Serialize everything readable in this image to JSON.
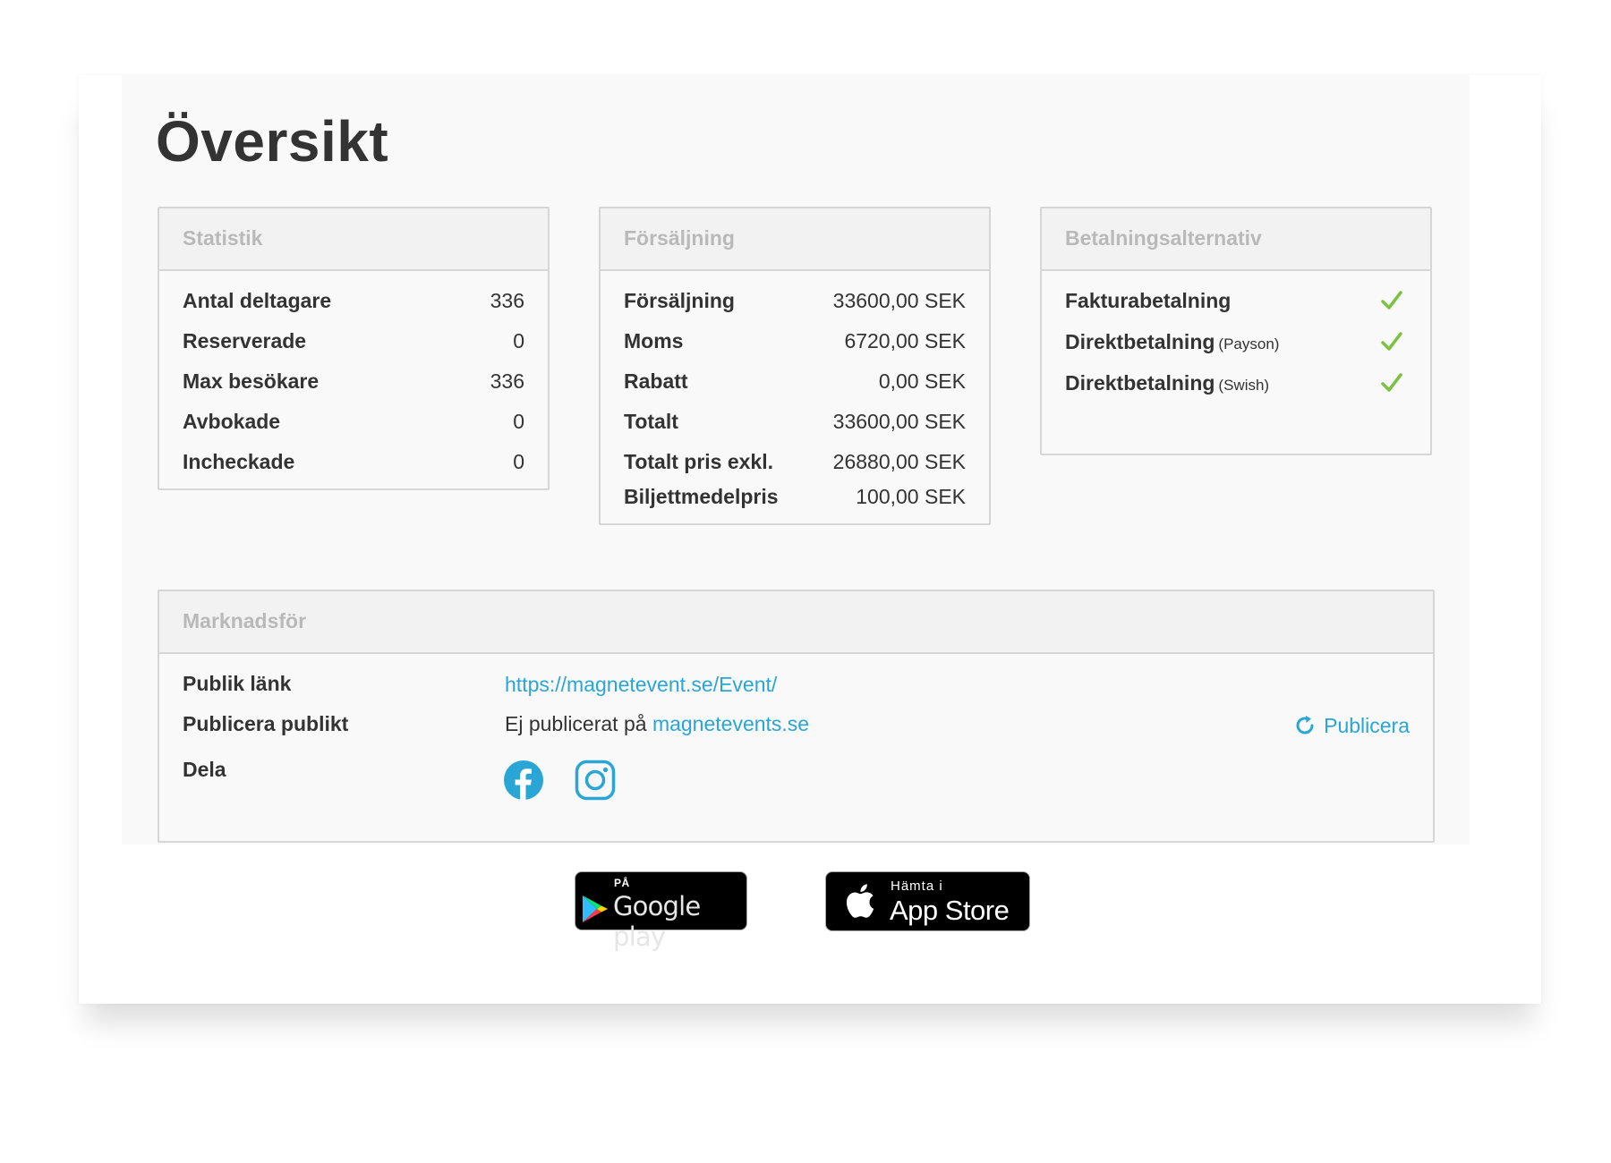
{
  "page": {
    "title": "Översikt"
  },
  "statistik": {
    "header": "Statistik",
    "rows": [
      {
        "label": "Antal deltagare",
        "value": "336"
      },
      {
        "label": "Reserverade",
        "value": "0"
      },
      {
        "label": "Max besökare",
        "value": "336"
      },
      {
        "label": "Avbokade",
        "value": "0"
      },
      {
        "label": "Incheckade",
        "value": "0"
      }
    ]
  },
  "forsaljning": {
    "header": "Försäljning",
    "rows": [
      {
        "label": "Försäljning",
        "value": "33600,00 SEK"
      },
      {
        "label": "Moms",
        "value": "6720,00 SEK"
      },
      {
        "label": "Rabatt",
        "value": "0,00 SEK"
      },
      {
        "label": "Totalt",
        "value": "33600,00 SEK"
      },
      {
        "label": "Totalt pris exkl.",
        "value": "26880,00 SEK"
      },
      {
        "label": "Biljettmedelpris",
        "value": "100,00 SEK"
      }
    ]
  },
  "betalning": {
    "header": "Betalningsalternativ",
    "check_color": "#7cc242",
    "rows": [
      {
        "label": "Fakturabetalning",
        "sub": "",
        "enabled": true
      },
      {
        "label": "Direktbetalning",
        "sub": "(Payson)",
        "enabled": true
      },
      {
        "label": "Direktbetalning",
        "sub": "(Swish)",
        "enabled": true
      }
    ]
  },
  "marknadsfor": {
    "header": "Marknadsför",
    "public_link_label": "Publik länk",
    "public_link_url": "https://magnetevent.se/Event/",
    "publish_label": "Publicera publikt",
    "publish_status_text": "Ej publicerat på",
    "publish_status_link": "magnetevents.se",
    "publish_button": "Publicera",
    "share_label": "Dela",
    "social_icons": [
      "facebook-icon",
      "instagram-icon"
    ],
    "link_color": "#2aa6d6"
  },
  "stores": {
    "google": {
      "top": "PÅ",
      "name": "Google play"
    },
    "apple": {
      "top": "Hämta i",
      "name": "App Store"
    }
  }
}
